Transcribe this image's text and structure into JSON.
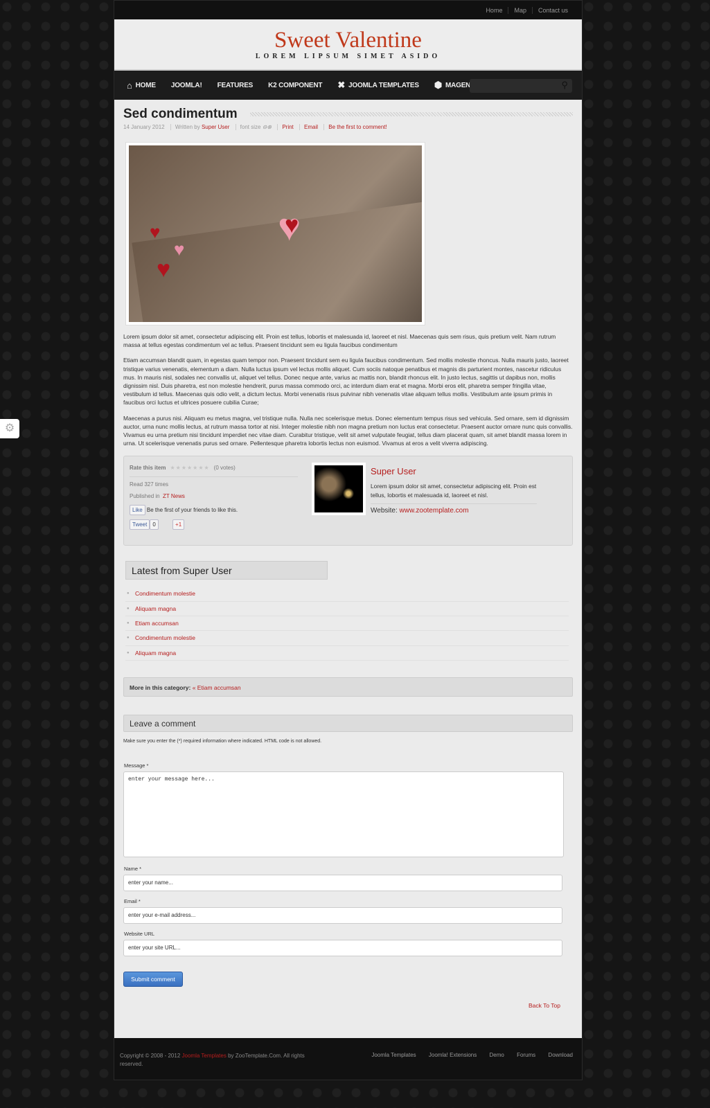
{
  "topbar": {
    "links": [
      "Home",
      "Map",
      "Contact us"
    ]
  },
  "header": {
    "logo": "Sweet Valentine",
    "slogan": "LOREM LIPSUM SIMET ASIDO"
  },
  "nav": {
    "items": [
      "HOME",
      "JOOMLA!",
      "FEATURES",
      "K2 COMPONENT",
      "JOOMLA TEMPLATES",
      "MAGENTO THEMES"
    ]
  },
  "article": {
    "title": "Sed condimentum",
    "date": "14 January 2012",
    "written_by": "Written by",
    "author": "Super User",
    "font_size": "font size",
    "print": "Print",
    "email": "Email",
    "comment_link": "Be the first to comment!",
    "paragraphs": [
      "Lorem ipsum dolor sit amet, consectetur adipiscing elit. Proin est tellus, lobortis et malesuada id, laoreet et nisl. Maecenas quis sem risus, quis pretium velit. Nam rutrum massa at tellus egestas condimentum vel ac tellus. Praesent tincidunt sem eu ligula faucibus condimentum",
      "Etiam accumsan blandit quam, in egestas quam tempor non. Praesent tincidunt sem eu ligula faucibus condimentum. Sed mollis molestie rhoncus. Nulla mauris justo, laoreet tristique varius venenatis, elementum a diam. Nulla luctus ipsum vel lectus mollis aliquet. Cum sociis natoque penatibus et magnis dis parturient montes, nascetur ridiculus mus. In mauris nisl, sodales nec convallis ut, aliquet vel tellus. Donec neque ante, varius ac mattis non, blandit rhoncus elit. In justo lectus, sagittis ut dapibus non, mollis dignissim nisl. Duis pharetra, est non molestie hendrerit, purus massa commodo orci, ac interdum diam erat et magna. Morbi eros elit, pharetra semper fringilla vitae, vestibulum id tellus. Maecenas quis odio velit, a dictum lectus. Morbi venenatis risus pulvinar nibh venenatis vitae aliquam tellus mollis. Vestibulum ante ipsum primis in faucibus orci luctus et ultrices posuere cubilia Curae;",
      "Maecenas a purus nisi. Aliquam eu metus magna, vel tristique nulla. Nulla nec scelerisque metus. Donec elementum tempus risus sed vehicula. Sed ornare, sem id dignissim auctor, urna nunc mollis lectus, at rutrum massa tortor at nisi. Integer molestie nibh non magna pretium non luctus erat consectetur. Praesent auctor ornare nunc quis convallis. Vivamus eu urna pretium nisi tincidunt imperdiet nec vitae diam. Curabitur tristique, velit sit amet vulputate feugiat, tellus diam placerat quam, sit amet blandit massa lorem in urna. Ut scelerisque venenatis purus sed ornare. Pellentesque pharetra lobortis lectus non euismod. Vivamus at eros a velit viverra adipiscing."
    ]
  },
  "info": {
    "rate_label": "Rate this item",
    "rating": 0,
    "votes": "(0 votes)",
    "read": "Read 327 times",
    "published_in": "Published in",
    "category": "ZT News",
    "like": "Like",
    "like_text": "Be the first of your friends to like this.",
    "tweet": "Tweet",
    "tweet_count": "0",
    "plus": "+1",
    "author_name": "Super User",
    "author_bio": "Lorem ipsum dolor sit amet, consectetur adipiscing elit. Proin est tellus, lobortis et malesuada id, laoreet et nisl.",
    "website_label": "Website:",
    "website": "www.zootemplate.com"
  },
  "latest": {
    "title": "Latest from Super User",
    "items": [
      "Condimentum molestie",
      "Aliquam magna",
      "Etiam accumsan",
      "Condimentum molestie",
      "Aliquam magna"
    ]
  },
  "more": {
    "label": "More in this category:",
    "link": "« Etiam accumsan"
  },
  "comment": {
    "title": "Leave a comment",
    "note": "Make sure you enter the (*) required information where indicated. HTML code is not allowed.",
    "message_label": "Message *",
    "message_placeholder": "enter your message here...",
    "name_label": "Name *",
    "name_placeholder": "enter your name...",
    "email_label": "Email *",
    "email_placeholder": "enter your e-mail address...",
    "url_label": "Website URL",
    "url_placeholder": "enter your site URL...",
    "submit": "Submit comment"
  },
  "back_to_top": "Back To Top",
  "footer": {
    "copy_pre": "Copyright © 2008 - 2012 ",
    "copy_link": "Joomla Templates",
    "copy_post": " by ZooTemplate.Com. All rights reserved.",
    "links": [
      "Joomla Templates",
      "Joomla! Extensions",
      "Demo",
      "Forums",
      "Download"
    ]
  },
  "colors": {
    "accent": "#b51d1d",
    "logo": "#c0391b",
    "button": "#4a84d0"
  }
}
